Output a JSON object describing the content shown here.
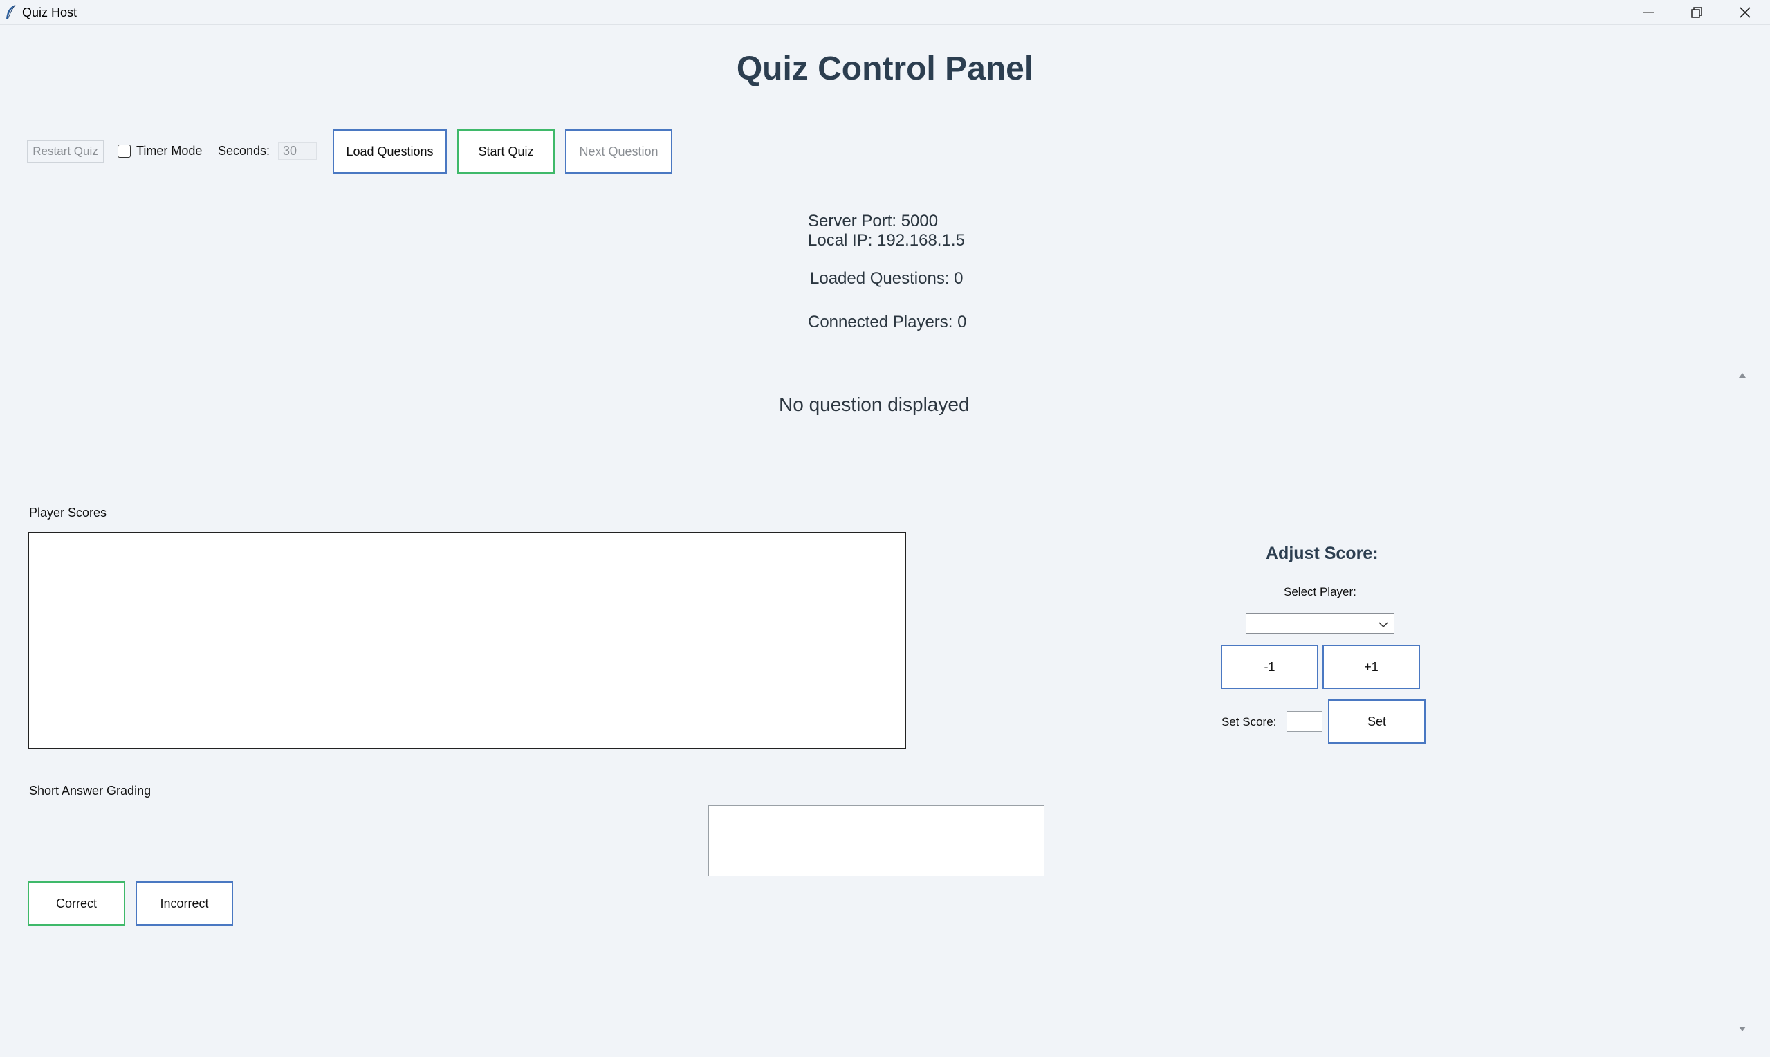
{
  "window": {
    "title": "Quiz Host",
    "icons": {
      "app": "feather-icon",
      "minimize": "minimize-icon",
      "maximize": "restore-icon",
      "close": "close-icon"
    }
  },
  "page": {
    "title": "Quiz Control Panel"
  },
  "toolbar": {
    "restart_label": "Restart Quiz",
    "timer_mode_label": "Timer Mode",
    "timer_mode_checked": false,
    "seconds_label": "Seconds:",
    "seconds_value": "30",
    "load_label": "Load Questions",
    "start_label": "Start Quiz",
    "next_label": "Next Question"
  },
  "server": {
    "port_text": "Server Port: 5000",
    "ip_text": "Local IP: 192.168.1.5",
    "loaded_questions_text": "Loaded Questions: 0",
    "connected_players_text": "Connected Players: 0"
  },
  "question": {
    "text": "No question displayed"
  },
  "scores": {
    "section_label": "Player Scores",
    "rows": []
  },
  "grading": {
    "section_label": "Short Answer Grading",
    "answer_text": "",
    "correct_label": "Correct",
    "incorrect_label": "Incorrect"
  },
  "adjust": {
    "title": "Adjust Score:",
    "select_label": "Select Player:",
    "selected_player": "",
    "minus_label": "-1",
    "plus_label": "+1",
    "set_score_label": "Set Score:",
    "set_score_value": "",
    "set_label": "Set"
  },
  "colors": {
    "accent_blue": "#4a78c2",
    "accent_green": "#3fb96a",
    "title": "#2c3e50",
    "background": "#f1f4f8"
  }
}
